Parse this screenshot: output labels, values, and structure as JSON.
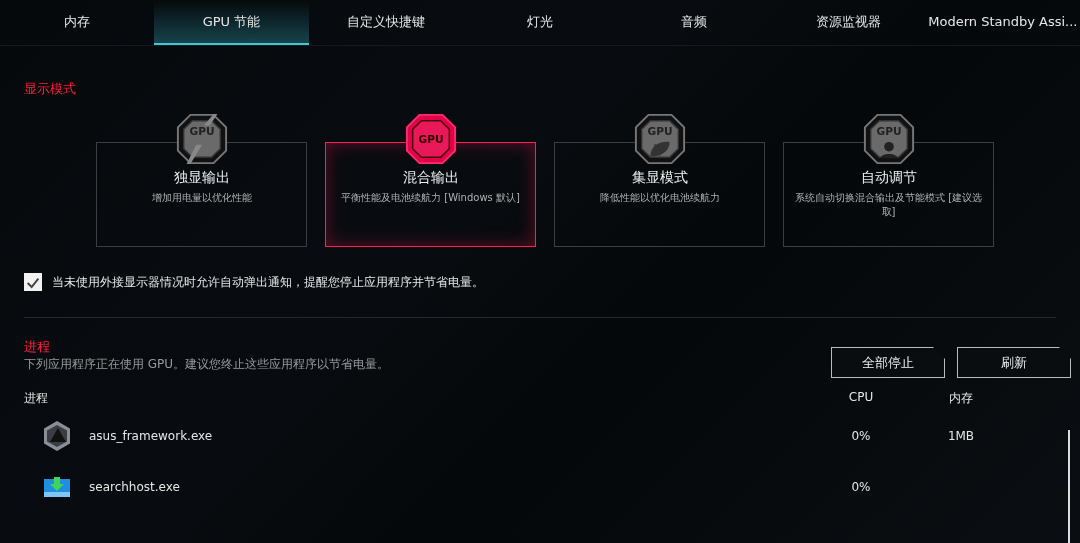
{
  "tabs": [
    {
      "label": "内存",
      "selected": false
    },
    {
      "label": "GPU 节能",
      "selected": true
    },
    {
      "label": "自定义快捷键",
      "selected": false
    },
    {
      "label": "灯光",
      "selected": false
    },
    {
      "label": "音频",
      "selected": false
    },
    {
      "label": "资源监视器",
      "selected": false
    },
    {
      "label": "Modern Standby Assi...",
      "selected": false
    }
  ],
  "display_mode": {
    "title": "显示模式",
    "modes": [
      {
        "kind": "discrete",
        "icon_text": "GPU",
        "name": "独显输出",
        "description": "增加用电量以优化性能",
        "selected": false
      },
      {
        "kind": "hybrid",
        "icon_text": "GPU",
        "name": "混合输出",
        "description": "平衡性能及电池续航力 [Windows 默认]",
        "selected": true
      },
      {
        "kind": "integrated",
        "icon_text": "GPU",
        "name": "集显模式",
        "description": "降低性能以优化电池续航力",
        "selected": false
      },
      {
        "kind": "auto",
        "icon_text": "GPU",
        "name": "自动调节",
        "description": "系统自动切换混合输出及节能模式 [建议选取]",
        "selected": false
      }
    ],
    "notify": {
      "label": "当未使用外接显示器情况时允许自动弹出通知，提醒您停止应用程序并节省电量。",
      "checked": true
    }
  },
  "processes": {
    "title": "进程",
    "subtitle": "下列应用程序正在使用 GPU。建议您终止这些应用程序以节省电量。",
    "buttons": [
      "全部停止",
      "刷新"
    ],
    "columns": [
      "进程",
      "CPU",
      "内存"
    ],
    "rows": [
      {
        "kind": "framework",
        "name": "asus_framework.exe",
        "cpu": "0%",
        "memory": "1MB"
      },
      {
        "kind": "download",
        "name": "searchhost.exe",
        "cpu": "0%"
      }
    ]
  }
}
